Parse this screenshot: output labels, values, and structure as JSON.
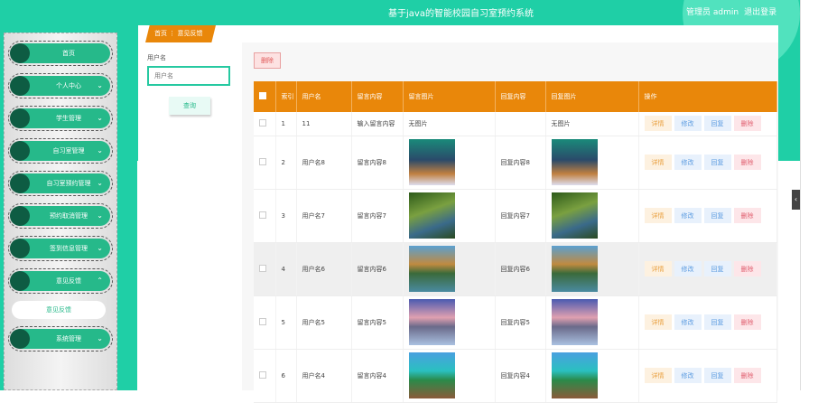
{
  "header": {
    "title": "基于java的智能校园自习室预约系统",
    "user": "管理员 admin",
    "logout": "退出登录"
  },
  "sidebar": {
    "items": [
      {
        "label": "首页",
        "chevron": ""
      },
      {
        "label": "个人中心",
        "chevron": "⌄"
      },
      {
        "label": "学生管理",
        "chevron": "⌄"
      },
      {
        "label": "自习室管理",
        "chevron": "⌄"
      },
      {
        "label": "自习室预约管理",
        "chevron": "⌄"
      },
      {
        "label": "预约取消管理",
        "chevron": "⌄"
      },
      {
        "label": "签到信息管理",
        "chevron": "⌄"
      },
      {
        "label": "意见反馈",
        "chevron": "⌃"
      }
    ],
    "sub_item": "意见反馈",
    "last_item": {
      "label": "系统管理",
      "chevron": "⌄"
    }
  },
  "breadcrumb": {
    "home": "首页",
    "sep": "⋮",
    "current": "意见反馈"
  },
  "search": {
    "label": "用户名",
    "placeholder": "用户名",
    "button": "查询"
  },
  "toolbar": {
    "delete": "删除"
  },
  "table": {
    "headers": [
      "索引",
      "用户名",
      "留言内容",
      "留言图片",
      "回复内容",
      "回复图片",
      "操作"
    ],
    "actions": [
      "详情",
      "修改",
      "回复",
      "删除"
    ],
    "rows": [
      {
        "idx": "1",
        "user": "11",
        "content": "输入留言内容",
        "img": "无图片",
        "reply": "",
        "rimg": "无图片",
        "type": "none"
      },
      {
        "idx": "2",
        "user": "用户名8",
        "content": "留言内容8",
        "reply": "回复内容8",
        "type": "aurora"
      },
      {
        "idx": "3",
        "user": "用户名7",
        "content": "留言内容7",
        "reply": "回复内容7",
        "type": "forest"
      },
      {
        "idx": "4",
        "user": "用户名6",
        "content": "留言内容6",
        "reply": "回复内容6",
        "type": "mountain"
      },
      {
        "idx": "5",
        "user": "用户名5",
        "content": "留言内容5",
        "reply": "回复内容5",
        "type": "sunset"
      },
      {
        "idx": "6",
        "user": "用户名4",
        "content": "留言内容4",
        "reply": "回复内容4",
        "type": "sea"
      }
    ]
  },
  "colors": {
    "teal": "#1fcfa6",
    "orange": "#e9870a",
    "nav_green": "#26b98a"
  }
}
